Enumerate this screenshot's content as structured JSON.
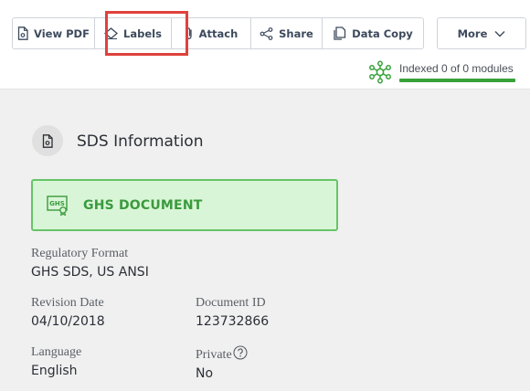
{
  "toolbar": {
    "buttons": [
      {
        "label": "View PDF",
        "icon": "pdf-file-icon"
      },
      {
        "label": "Labels",
        "icon": "label-tag-icon"
      },
      {
        "label": "Attach",
        "icon": "paperclip-icon"
      },
      {
        "label": "Share",
        "icon": "share-icon"
      },
      {
        "label": "Data Copy",
        "icon": "data-copy-icon"
      }
    ],
    "more_label": "More"
  },
  "indexed": {
    "text": "Indexed 0 of 0 modules",
    "progress": 1.0,
    "icon": "modules-network-icon",
    "color": "#38a13a"
  },
  "section": {
    "title": "SDS Information",
    "icon": "document-settings-icon"
  },
  "ghs": {
    "label": "GHS DOCUMENT",
    "icon": "ghs-certificate-icon",
    "color": "#3a9a3d"
  },
  "fields": {
    "regulatory_format": {
      "label": "Regulatory Format",
      "value": "GHS SDS, US ANSI"
    },
    "revision_date": {
      "label": "Revision Date",
      "value": "04/10/2018"
    },
    "document_id": {
      "label": "Document ID",
      "value": "123732866"
    },
    "language": {
      "label": "Language",
      "value": "English"
    },
    "private": {
      "label": "Private",
      "value": "No"
    }
  },
  "colors": {
    "highlight": "#e0413c",
    "panel_bg": "#f0f0f0"
  }
}
